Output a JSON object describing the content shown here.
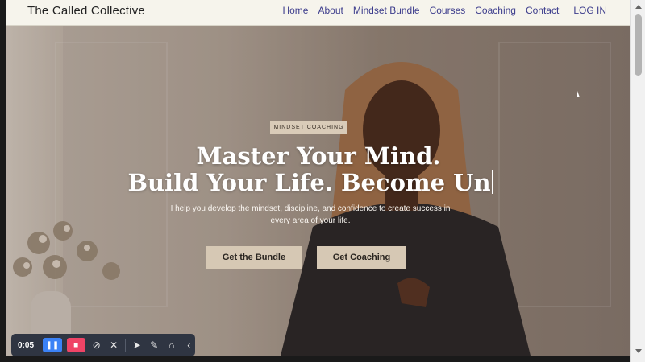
{
  "header": {
    "brand": "The Called Collective",
    "nav": [
      "Home",
      "About",
      "Mindset Bundle",
      "Courses",
      "Coaching",
      "Contact"
    ],
    "login": "LOG IN"
  },
  "hero": {
    "badge": "MINDSET COACHING",
    "headline_line1": "Master Your Mind.",
    "headline_line2": "Build Your Life. Become Un",
    "subtext": "I help you develop the mindset, discipline, and confidence to create success in every area of your life.",
    "primary_button": "Get the Bundle",
    "secondary_button": "Get Coaching"
  },
  "recorder": {
    "time": "0:05",
    "icons": [
      "pause-icon",
      "stop-icon",
      "camera-off-icon",
      "mic-off-icon",
      "pointer-icon",
      "pen-icon",
      "eraser-icon",
      "collapse-icon"
    ]
  },
  "colors": {
    "nav_link": "#3c3c8c",
    "button_bg": "#d6c8b4",
    "badge_bg": "#d9cbb8",
    "recorder_pause": "#3b82f6",
    "recorder_stop": "#ef4466"
  }
}
